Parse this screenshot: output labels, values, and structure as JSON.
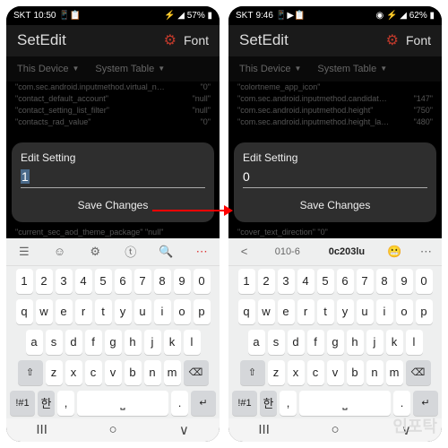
{
  "left": {
    "status": {
      "carrier": "SKT",
      "time": "10:50",
      "icons": "📶 57%",
      "right_icons": "⚡ ◢ 57% ▮"
    },
    "header": {
      "title": "SetEdit",
      "font": "Font"
    },
    "tabs": {
      "device": "This Device",
      "system": "System Table"
    },
    "rows": [
      {
        "k": "\"com.sec.android.inputmethod.virtual_navigation_bar_height\"",
        "v": "\"0\""
      },
      {
        "k": "\"contact_default_account\"",
        "v": "\"null\""
      },
      {
        "k": "\"contact_setting_list_filter\"",
        "v": "\"null\""
      },
      {
        "k": "\"contacts_rad_value\"",
        "v": "\"0\""
      }
    ],
    "dialog": {
      "title": "Edit Setting",
      "value": "1",
      "btn": "Save Changes"
    },
    "under": "\"current_sec_aod_theme_package\"    \"null\"",
    "toolbar": [
      "☰",
      "☺",
      "⚙",
      "ⓣ",
      "🔍",
      "⋯"
    ],
    "num_row": [
      "1",
      "2",
      "3",
      "4",
      "5",
      "6",
      "7",
      "8",
      "9",
      "0"
    ],
    "row1": [
      "q",
      "w",
      "e",
      "r",
      "t",
      "y",
      "u",
      "i",
      "o",
      "p"
    ],
    "row2": [
      "a",
      "s",
      "d",
      "f",
      "g",
      "h",
      "j",
      "k",
      "l"
    ],
    "row3": {
      "shift": "⇧",
      "keys": [
        "z",
        "x",
        "c",
        "v",
        "b",
        "n",
        "m"
      ],
      "del": "⌫"
    },
    "row4": {
      "sym": "!#1",
      "lang": "한",
      "comma": ",",
      "space": "",
      "dot": ".",
      "enter": "↵"
    },
    "nav": {
      "recent": "III",
      "home": "○",
      "back": "∨"
    }
  },
  "right": {
    "status": {
      "carrier": "SKT",
      "time": "9:46",
      "icons": "📶 62%",
      "right_icons": "◉ ⚡ ◢ 62% ▮"
    },
    "header": {
      "title": "SetEdit",
      "font": "Font"
    },
    "tabs": {
      "device": "This Device",
      "system": "System Table"
    },
    "rows": [
      {
        "k": "\"colortneme_app_icon\"",
        "v": ""
      },
      {
        "k": "\"com.sec.android.inputmethod.candidate_height\"",
        "v": "\"147\""
      },
      {
        "k": "\"com.sec.android.inputmethod.height\"",
        "v": "\"750\""
      },
      {
        "k": "\"com.sec.android.inputmethod.height_landscape\"",
        "v": "\"480\""
      }
    ],
    "dialog": {
      "title": "Edit Setting",
      "value": "0",
      "btn": "Save Changes"
    },
    "under": "\"cover_text_direction\"    \"0\"",
    "toolbar_text": {
      "a": "<",
      "b": "010-6",
      "c": "0c203lu",
      "d": "😬",
      "e": "⋯"
    },
    "num_row": [
      "1",
      "2",
      "3",
      "4",
      "5",
      "6",
      "7",
      "8",
      "9",
      "0"
    ],
    "row1": [
      "q",
      "w",
      "e",
      "r",
      "t",
      "y",
      "u",
      "i",
      "o",
      "p"
    ],
    "row2": [
      "a",
      "s",
      "d",
      "f",
      "g",
      "h",
      "j",
      "k",
      "l"
    ],
    "row3": {
      "shift": "⇧",
      "keys": [
        "z",
        "x",
        "c",
        "v",
        "b",
        "n",
        "m"
      ],
      "del": "⌫"
    },
    "row4": {
      "sym": "!#1",
      "lang": "한",
      "comma": ",",
      "space": "",
      "dot": ".",
      "enter": "↵"
    },
    "nav": {
      "recent": "III",
      "home": "○",
      "back": "∨"
    }
  },
  "watermark": "인포탁"
}
